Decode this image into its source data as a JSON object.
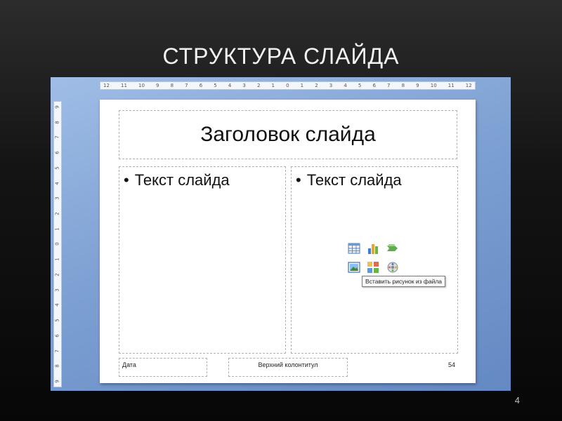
{
  "page": {
    "title": "Структура слайда",
    "number": "4"
  },
  "ruler": {
    "horizontal_labels": [
      "12",
      "11",
      "10",
      "9",
      "8",
      "7",
      "6",
      "5",
      "4",
      "3",
      "2",
      "1",
      "0",
      "1",
      "2",
      "3",
      "4",
      "5",
      "6",
      "7",
      "8",
      "9",
      "10",
      "11",
      "12"
    ],
    "vertical_labels": [
      "9",
      "8",
      "7",
      "6",
      "5",
      "4",
      "3",
      "2",
      "1",
      "0",
      "1",
      "2",
      "3",
      "4",
      "5",
      "6",
      "7",
      "8",
      "9"
    ]
  },
  "slide": {
    "title_placeholder": "Заголовок слайда",
    "left_content": {
      "bullet": "•",
      "text": "Текст слайда"
    },
    "right_content": {
      "bullet": "•",
      "text": "Текст слайда"
    },
    "content_icons": [
      "insert-table-icon",
      "insert-chart-icon",
      "insert-smartart-icon",
      "insert-picture-icon",
      "insert-clipart-icon",
      "insert-media-icon"
    ],
    "tooltip": "Вставить рисунок из файла",
    "footer": {
      "date": "Дата",
      "header": "Верхний колонтитул",
      "slide_number": "54"
    }
  },
  "colors": {
    "background": "#141414",
    "title_text": "#f2f2f2",
    "workspace": "#7ea1d3",
    "slide": "#ffffff"
  }
}
